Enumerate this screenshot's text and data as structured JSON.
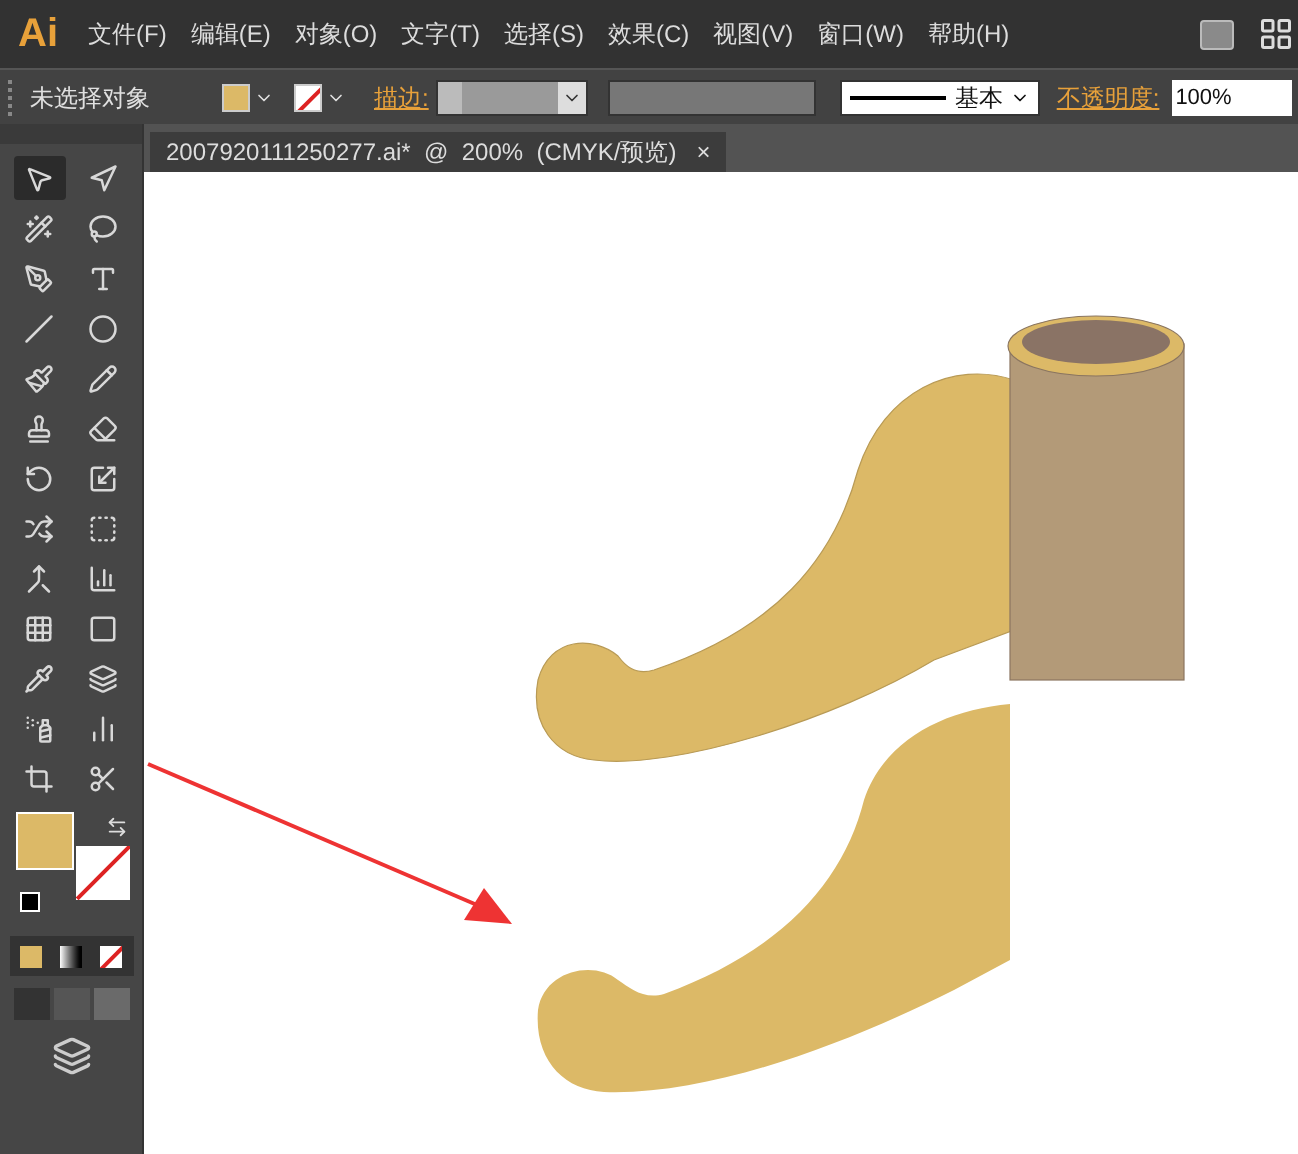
{
  "app_logo": "Ai",
  "menu": [
    "文件(F)",
    "编辑(E)",
    "对象(O)",
    "文字(T)",
    "选择(S)",
    "效果(C)",
    "视图(V)",
    "窗口(W)",
    "帮助(H)"
  ],
  "control_bar": {
    "selection": "未选择对象",
    "stroke_label": "描边:",
    "stroke_style": "基本",
    "opacity_label": "不透明度:",
    "opacity": "100%"
  },
  "document_tab": {
    "title": "2007920111250277.ai*  @  200%  (CMYK/预览)",
    "close": "×"
  },
  "tools": [
    {
      "selected": true
    },
    {
      "selected": false
    },
    {
      "selected": false
    },
    {
      "selected": false
    },
    {
      "selected": false
    },
    {
      "selected": false
    },
    {
      "selected": false
    },
    {
      "selected": false
    },
    {
      "selected": false
    },
    {
      "selected": false
    },
    {
      "selected": false
    },
    {
      "selected": false
    },
    {
      "selected": false
    },
    {
      "selected": false
    },
    {
      "selected": false
    },
    {
      "selected": false
    },
    {
      "selected": false
    },
    {
      "selected": false
    },
    {
      "selected": false
    },
    {
      "selected": false
    },
    {
      "selected": false
    },
    {
      "selected": false
    },
    {
      "selected": false
    },
    {
      "selected": false
    },
    {
      "selected": false
    },
    {
      "selected": false
    }
  ]
}
